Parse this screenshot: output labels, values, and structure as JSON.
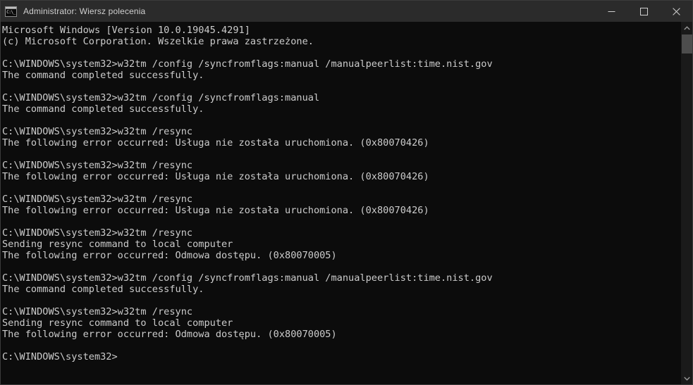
{
  "window": {
    "title": "Administrator: Wiersz polecenia",
    "icon": "cmd-icon",
    "icon_glyph": "C:\\_",
    "colors": {
      "titlebar_bg": "#2b2b2b",
      "console_bg": "#0c0c0c",
      "console_fg": "#cccccc",
      "scrollbar_track": "#1a1a1a",
      "scrollbar_thumb": "#4d4d4d"
    },
    "controls": {
      "minimize_label": "Minimize",
      "maximize_label": "Maximize",
      "close_label": "Close"
    }
  },
  "scrollbar": {
    "up_arrow_label": "Scroll up",
    "down_arrow_label": "Scroll down",
    "thumb_label": "Scroll thumb"
  },
  "console": {
    "lines": [
      "Microsoft Windows [Version 10.0.19045.4291]",
      "(c) Microsoft Corporation. Wszelkie prawa zastrzeżone.",
      "",
      "C:\\WINDOWS\\system32>w32tm /config /syncfromflags:manual /manualpeerlist:time.nist.gov",
      "The command completed successfully.",
      "",
      "C:\\WINDOWS\\system32>w32tm /config /syncfromflags:manual",
      "The command completed successfully.",
      "",
      "C:\\WINDOWS\\system32>w32tm /resync",
      "The following error occurred: Usługa nie została uruchomiona. (0x80070426)",
      "",
      "C:\\WINDOWS\\system32>w32tm /resync",
      "The following error occurred: Usługa nie została uruchomiona. (0x80070426)",
      "",
      "C:\\WINDOWS\\system32>w32tm /resync",
      "The following error occurred: Usługa nie została uruchomiona. (0x80070426)",
      "",
      "C:\\WINDOWS\\system32>w32tm /resync",
      "Sending resync command to local computer",
      "The following error occurred: Odmowa dostępu. (0x80070005)",
      "",
      "C:\\WINDOWS\\system32>w32tm /config /syncfromflags:manual /manualpeerlist:time.nist.gov",
      "The command completed successfully.",
      "",
      "C:\\WINDOWS\\system32>w32tm /resync",
      "Sending resync command to local computer",
      "The following error occurred: Odmowa dostępu. (0x80070005)",
      "",
      "C:\\WINDOWS\\system32>"
    ]
  }
}
